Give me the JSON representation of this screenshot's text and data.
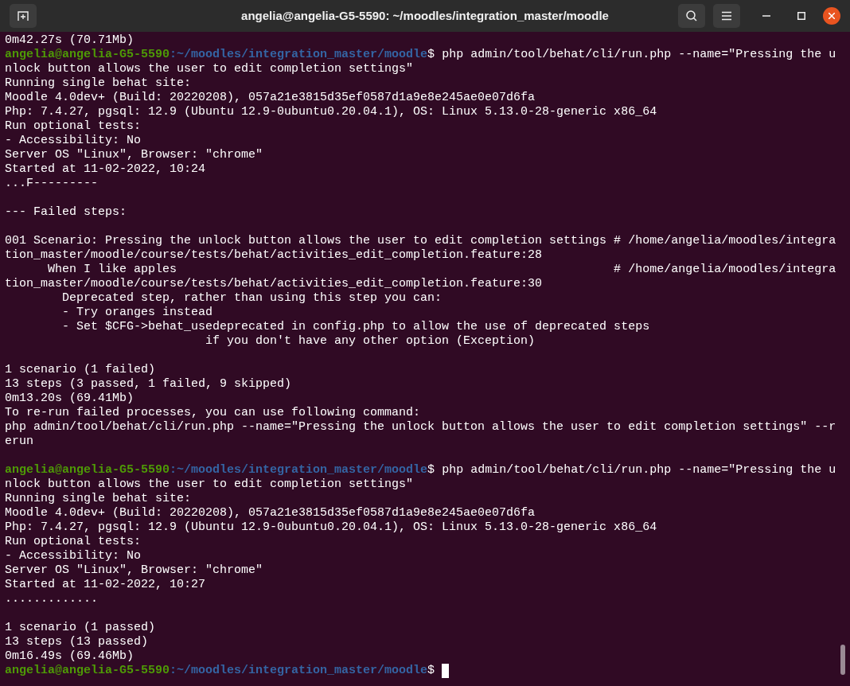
{
  "window": {
    "title": "angelia@angelia-G5-5590: ~/moodles/integration_master/moodle"
  },
  "terminal": {
    "lines": [
      {
        "kind": "output",
        "text": "0m42.27s (70.71Mb)"
      },
      {
        "kind": "prompt",
        "user_host": "angelia@angelia-G5-5590",
        "path": ":~/moodles/integration_master/moodle",
        "symbol": "$",
        "command": "php admin/tool/behat/cli/run.php --name=\"Pressing the u",
        "cursor": false
      },
      {
        "kind": "output",
        "text": "nlock button allows the user to edit completion settings\""
      },
      {
        "kind": "output",
        "text": "Running single behat site:"
      },
      {
        "kind": "output",
        "text": "Moodle 4.0dev+ (Build: 20220208), 057a21e3815d35ef0587d1a9e8e245ae0e07d6fa"
      },
      {
        "kind": "output",
        "text": "Php: 7.4.27, pgsql: 12.9 (Ubuntu 12.9-0ubuntu0.20.04.1), OS: Linux 5.13.0-28-generic x86_64"
      },
      {
        "kind": "output",
        "text": "Run optional tests:"
      },
      {
        "kind": "output",
        "text": "- Accessibility: No"
      },
      {
        "kind": "output",
        "text": "Server OS \"Linux\", Browser: \"chrome\""
      },
      {
        "kind": "output",
        "text": "Started at 11-02-2022, 10:24"
      },
      {
        "kind": "output",
        "text": "...F---------"
      },
      {
        "kind": "blank"
      },
      {
        "kind": "output",
        "text": "--- Failed steps:"
      },
      {
        "kind": "blank"
      },
      {
        "kind": "output",
        "text": "001 Scenario: Pressing the unlock button allows the user to edit completion settings # /home/angelia/moodles/integra"
      },
      {
        "kind": "output",
        "text": "tion_master/moodle/course/tests/behat/activities_edit_completion.feature:28"
      },
      {
        "kind": "output",
        "text": "      When I like apples                                                             # /home/angelia/moodles/integra"
      },
      {
        "kind": "output",
        "text": "tion_master/moodle/course/tests/behat/activities_edit_completion.feature:30"
      },
      {
        "kind": "output",
        "text": "        Deprecated step, rather than using this step you can:"
      },
      {
        "kind": "output",
        "text": "        - Try oranges instead"
      },
      {
        "kind": "output",
        "text": "        - Set $CFG->behat_usedeprecated in config.php to allow the use of deprecated steps"
      },
      {
        "kind": "output",
        "text": "                            if you don't have any other option (Exception)"
      },
      {
        "kind": "blank"
      },
      {
        "kind": "output",
        "text": "1 scenario (1 failed)"
      },
      {
        "kind": "output",
        "text": "13 steps (3 passed, 1 failed, 9 skipped)"
      },
      {
        "kind": "output",
        "text": "0m13.20s (69.41Mb)"
      },
      {
        "kind": "output",
        "text": "To re-run failed processes, you can use following command:"
      },
      {
        "kind": "output",
        "text": "php admin/tool/behat/cli/run.php --name=\"Pressing the unlock button allows the user to edit completion settings\" --r"
      },
      {
        "kind": "output",
        "text": "erun"
      },
      {
        "kind": "blank"
      },
      {
        "kind": "prompt",
        "user_host": "angelia@angelia-G5-5590",
        "path": ":~/moodles/integration_master/moodle",
        "symbol": "$",
        "command": "php admin/tool/behat/cli/run.php --name=\"Pressing the u",
        "cursor": false
      },
      {
        "kind": "output",
        "text": "nlock button allows the user to edit completion settings\""
      },
      {
        "kind": "output",
        "text": "Running single behat site:"
      },
      {
        "kind": "output",
        "text": "Moodle 4.0dev+ (Build: 20220208), 057a21e3815d35ef0587d1a9e8e245ae0e07d6fa"
      },
      {
        "kind": "output",
        "text": "Php: 7.4.27, pgsql: 12.9 (Ubuntu 12.9-0ubuntu0.20.04.1), OS: Linux 5.13.0-28-generic x86_64"
      },
      {
        "kind": "output",
        "text": "Run optional tests:"
      },
      {
        "kind": "output",
        "text": "- Accessibility: No"
      },
      {
        "kind": "output",
        "text": "Server OS \"Linux\", Browser: \"chrome\""
      },
      {
        "kind": "output",
        "text": "Started at 11-02-2022, 10:27"
      },
      {
        "kind": "output",
        "text": "............."
      },
      {
        "kind": "blank"
      },
      {
        "kind": "output",
        "text": "1 scenario (1 passed)"
      },
      {
        "kind": "output",
        "text": "13 steps (13 passed)"
      },
      {
        "kind": "output",
        "text": "0m16.49s (69.46Mb)"
      },
      {
        "kind": "prompt",
        "user_host": "angelia@angelia-G5-5590",
        "path": ":~/moodles/integration_master/moodle",
        "symbol": "$",
        "cursor": true
      }
    ]
  }
}
